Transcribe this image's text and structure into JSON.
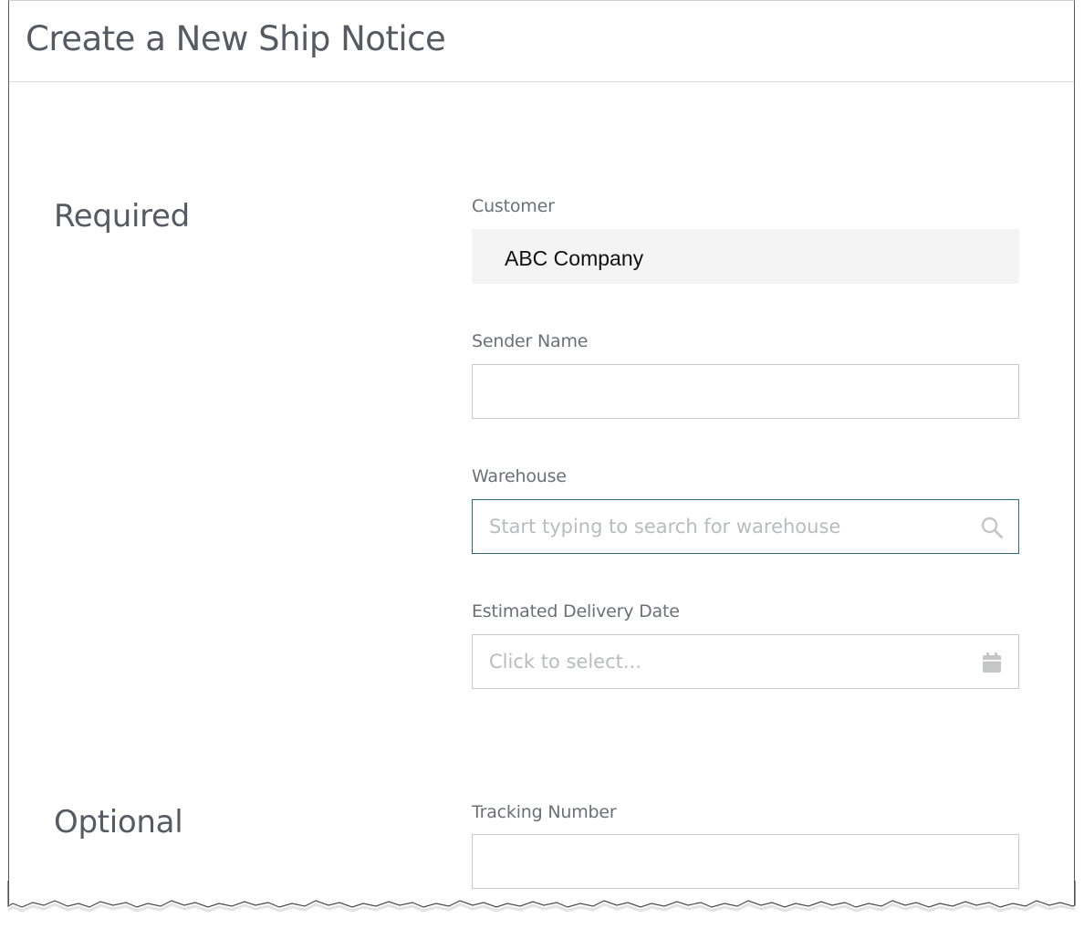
{
  "page": {
    "title": "Create a New Ship Notice"
  },
  "sections": {
    "required": {
      "heading": "Required"
    },
    "optional": {
      "heading": "Optional"
    }
  },
  "fields": {
    "customer": {
      "label": "Customer",
      "value": "ABC Company"
    },
    "sender_name": {
      "label": "Sender Name",
      "value": "",
      "placeholder": ""
    },
    "warehouse": {
      "label": "Warehouse",
      "value": "",
      "placeholder": "Start typing to search for warehouse",
      "icon": "search-icon"
    },
    "estimated_delivery_date": {
      "label": "Estimated Delivery Date",
      "value": "",
      "placeholder": "Click to select...",
      "icon": "calendar-icon"
    },
    "tracking_number": {
      "label": "Tracking Number",
      "value": "",
      "placeholder": ""
    }
  },
  "colors": {
    "text": "#565a61",
    "label": "#6b7077",
    "border": "#c9c9c9",
    "focus_border": "#2d6b75",
    "readonly_bg": "#f4f4f4",
    "placeholder": "#b9bcbf",
    "icon": "#c4c6c8"
  }
}
